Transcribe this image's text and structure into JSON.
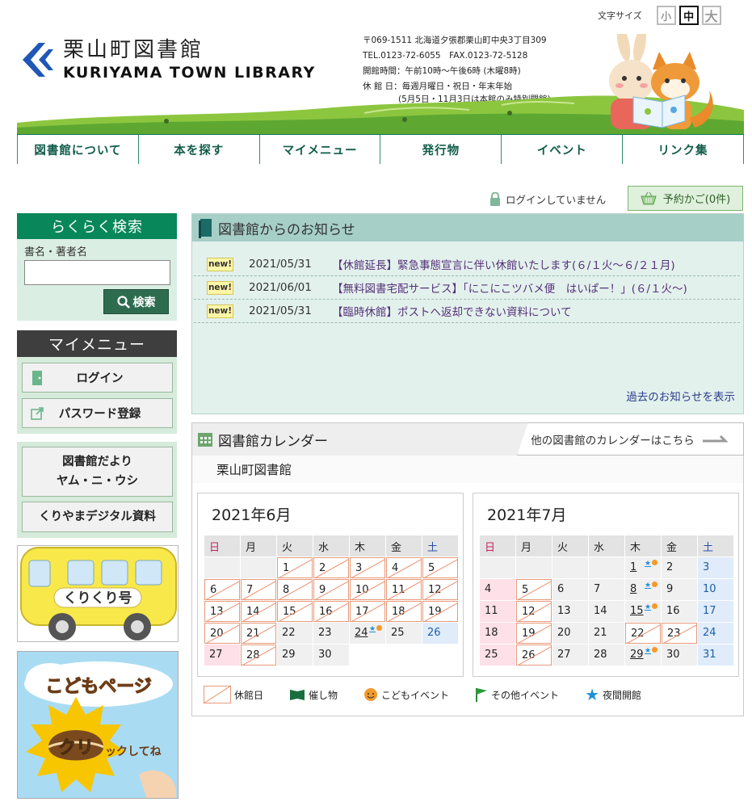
{
  "font_size": {
    "label": "文字サイズ",
    "small": "小",
    "medium": "中",
    "large": "大"
  },
  "header": {
    "logo_jp": "栗山町図書館",
    "logo_en": "KURIYAMA TOWN LIBRARY",
    "address": "〒069-1511 北海道夕張郡栗山町中央3丁目309",
    "tel": "TEL.0123-72-6055　FAX.0123-72-5128",
    "hours": "開館時間：午前10時～午後6時 (木曜8時)",
    "closed": "休 館 日：毎週月曜日・祝日・年末年始",
    "closed_note": "(5月5日・11月3日は本館のみ特別開館)"
  },
  "nav": [
    {
      "label": "図書館について"
    },
    {
      "label": "本を探す"
    },
    {
      "label": "マイメニュー"
    },
    {
      "label": "発行物"
    },
    {
      "label": "イベント"
    },
    {
      "label": "リンク集"
    }
  ],
  "login_status": "ログインしていません",
  "cart_label": "予約かご(0件)",
  "sidebar": {
    "search_title": "らくらく検索",
    "search_label": "書名・著者名",
    "search_value": "",
    "search_button": "検索",
    "mymenu_title": "マイメニュー",
    "login_button": "ログイン",
    "password_button": "パスワード登録",
    "newsletter_line1": "図書館だより",
    "newsletter_line2": "ヤム・ニ・ウシ",
    "digital_button": "くりやまデジタル資料",
    "bus_text": "くりくり号",
    "kids_title": "こどもページ",
    "kids_click": "クリ",
    "kids_sub": "ックしてね"
  },
  "news": {
    "title": "図書館からのお知らせ",
    "badge": "new!",
    "items": [
      {
        "date": "2021/05/31",
        "title": "【休館延長】緊急事態宣言に伴い休館いたします(６/１火～６/２１月)"
      },
      {
        "date": "2021/06/01",
        "title": "【無料図書宅配サービス】「にこにこツバメ便　はいぱー！」(６/１火～)"
      },
      {
        "date": "2021/05/31",
        "title": "【臨時休館】ポストへ返却できない資料について"
      }
    ],
    "more_link": "過去のお知らせを表示"
  },
  "calendar": {
    "title": "図書館カレンダー",
    "other_link": "他の図書館のカレンダーはこちら",
    "library_name": "栗山町図書館",
    "weekdays": [
      "日",
      "月",
      "火",
      "水",
      "木",
      "金",
      "土"
    ],
    "months": [
      {
        "title": "2021年6月",
        "lead_blanks": 2,
        "days": [
          {
            "d": "1",
            "closed": true
          },
          {
            "d": "2",
            "closed": true
          },
          {
            "d": "3",
            "closed": true
          },
          {
            "d": "4",
            "closed": true
          },
          {
            "d": "5",
            "closed": true
          },
          {
            "d": "6",
            "closed": true
          },
          {
            "d": "7",
            "closed": true
          },
          {
            "d": "8",
            "closed": true
          },
          {
            "d": "9",
            "closed": true
          },
          {
            "d": "10",
            "closed": true
          },
          {
            "d": "11",
            "closed": true
          },
          {
            "d": "12",
            "closed": true
          },
          {
            "d": "13",
            "closed": true
          },
          {
            "d": "14",
            "closed": true
          },
          {
            "d": "15",
            "closed": true
          },
          {
            "d": "16",
            "closed": true
          },
          {
            "d": "17",
            "closed": true
          },
          {
            "d": "18",
            "closed": true
          },
          {
            "d": "19",
            "closed": true
          },
          {
            "d": "20",
            "closed": true
          },
          {
            "d": "21",
            "closed": true
          },
          {
            "d": "22"
          },
          {
            "d": "23"
          },
          {
            "d": "24",
            "event": true
          },
          {
            "d": "25"
          },
          {
            "d": "26"
          },
          {
            "d": "27"
          },
          {
            "d": "28",
            "closed": true
          },
          {
            "d": "29"
          },
          {
            "d": "30"
          }
        ]
      },
      {
        "title": "2021年7月",
        "lead_blanks": 4,
        "days": [
          {
            "d": "1",
            "event": true
          },
          {
            "d": "2"
          },
          {
            "d": "3"
          },
          {
            "d": "4"
          },
          {
            "d": "5",
            "closed": true
          },
          {
            "d": "6"
          },
          {
            "d": "7"
          },
          {
            "d": "8",
            "event": true
          },
          {
            "d": "9"
          },
          {
            "d": "10"
          },
          {
            "d": "11"
          },
          {
            "d": "12",
            "closed": true
          },
          {
            "d": "13"
          },
          {
            "d": "14"
          },
          {
            "d": "15",
            "event": true
          },
          {
            "d": "16"
          },
          {
            "d": "17"
          },
          {
            "d": "18"
          },
          {
            "d": "19",
            "closed": true
          },
          {
            "d": "20"
          },
          {
            "d": "21"
          },
          {
            "d": "22",
            "closed": true
          },
          {
            "d": "23",
            "closed": true
          },
          {
            "d": "24"
          },
          {
            "d": "25"
          },
          {
            "d": "26",
            "closed": true
          },
          {
            "d": "27"
          },
          {
            "d": "28"
          },
          {
            "d": "29",
            "event": true
          },
          {
            "d": "30"
          },
          {
            "d": "31"
          }
        ]
      }
    ],
    "legend": {
      "closed": "休館日",
      "event": "催し物",
      "kids_event": "こどもイベント",
      "other_event": "その他イベント",
      "night": "夜間開館"
    }
  },
  "colors": {
    "brand_green": "#07875a",
    "nav_text": "#115c4a",
    "news_link": "#55307a",
    "closed_line": "#ee8d6a"
  }
}
